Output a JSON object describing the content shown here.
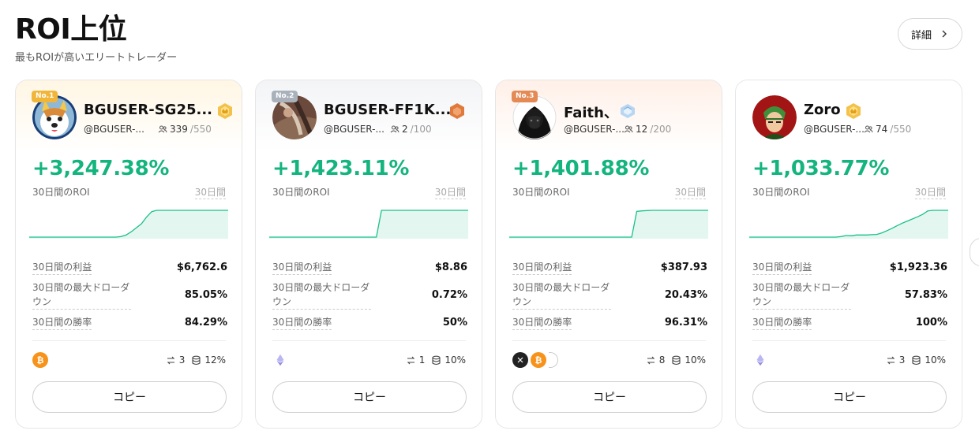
{
  "header": {
    "title": "ROI上位",
    "subtitle": "最もROIが高いエリートトレーダー",
    "detail_label": "詳細"
  },
  "cards": [
    {
      "rank": "No.1",
      "name": "BGUSER-SG25...",
      "handle": "@BGUSER-...",
      "followers": "339",
      "followers_max": "/550",
      "level": "gold-level-icon",
      "roi": "+3,247.38%",
      "roi_label": "30日間のROI",
      "period": "30日間",
      "spark": [
        0,
        0,
        0,
        0,
        0,
        0,
        0,
        0,
        0,
        0,
        0,
        0,
        0,
        0,
        0,
        0,
        0,
        0,
        0.02,
        0.08,
        0.2,
        0.35,
        0.5,
        0.75,
        0.95,
        1,
        1,
        1,
        1,
        1,
        1,
        1,
        1,
        1,
        1,
        1,
        1,
        1,
        1,
        1
      ],
      "stats": {
        "profit_label": "30日間の利益",
        "profit": "$6,762.6",
        "drawdown_label": "30日間の最大ドローダウン",
        "drawdown": "85.05%",
        "winrate_label": "30日間の勝率",
        "winrate": "84.29%"
      },
      "coins": [
        "btc"
      ],
      "trades": "3",
      "margin": "12%",
      "copy_label": "コピー"
    },
    {
      "rank": "No.2",
      "name": "BGUSER-FF1K...",
      "handle": "@BGUSER-...",
      "followers": "2",
      "followers_max": "/100",
      "level": "bronze-level-icon",
      "roi": "+1,423.11%",
      "roi_label": "30日間のROI",
      "period": "30日間",
      "spark": [
        0,
        0,
        0,
        0,
        0,
        0,
        0,
        0,
        0,
        0,
        0,
        0,
        0,
        0,
        0,
        0,
        0,
        0,
        0,
        0,
        0,
        0,
        1,
        1,
        1,
        1,
        1,
        1,
        1,
        1,
        1,
        1,
        1,
        1,
        1,
        1,
        1,
        1,
        1,
        1
      ],
      "stats": {
        "profit_label": "30日間の利益",
        "profit": "$8.86",
        "drawdown_label": "30日間の最大ドローダウン",
        "drawdown": "0.72%",
        "winrate_label": "30日間の勝率",
        "winrate": "50%"
      },
      "coins": [
        "eth"
      ],
      "trades": "1",
      "margin": "10%",
      "copy_label": "コピー"
    },
    {
      "rank": "No.3",
      "name": "Faith、",
      "handle": "@BGUSER-...",
      "followers": "12",
      "followers_max": "/200",
      "level": "diamond-level-icon",
      "roi": "+1,401.88%",
      "roi_label": "30日間のROI",
      "period": "30日間",
      "spark": [
        0,
        0,
        0,
        0,
        0,
        0,
        0,
        0,
        0,
        0,
        0,
        0,
        0,
        0,
        0,
        0,
        0,
        0,
        0,
        0,
        0,
        0,
        0,
        0,
        0,
        0.96,
        0.98,
        0.99,
        1,
        1,
        1,
        1,
        1,
        1,
        1,
        1,
        1,
        1,
        1,
        1
      ],
      "stats": {
        "profit_label": "30日間の利益",
        "profit": "$387.93",
        "drawdown_label": "30日間の最大ドローダウン",
        "drawdown": "20.43%",
        "winrate_label": "30日間の勝率",
        "winrate": "96.31%"
      },
      "coins": [
        "x",
        "btc",
        "partial"
      ],
      "trades": "8",
      "margin": "10%",
      "copy_label": "コピー"
    },
    {
      "rank": "",
      "name": "Zoro",
      "handle": "@BGUSER-...",
      "followers": "74",
      "followers_max": "/550",
      "level": "gold-level-icon",
      "roi": "+1,033.77%",
      "roi_label": "30日間のROI",
      "period": "30日間",
      "spark": [
        0,
        0,
        0,
        0,
        0,
        0,
        0,
        0,
        0,
        0,
        0,
        0,
        0,
        0,
        0,
        0,
        0,
        0,
        0.02,
        0.06,
        0.05,
        0.08,
        0.08,
        0.08,
        0.09,
        0.1,
        0.16,
        0.24,
        0.33,
        0.43,
        0.52,
        0.6,
        0.68,
        0.76,
        0.85,
        0.98,
        1,
        1,
        1,
        1
      ],
      "stats": {
        "profit_label": "30日間の利益",
        "profit": "$1,923.36",
        "drawdown_label": "30日間の最大ドローダウン",
        "drawdown": "57.83%",
        "winrate_label": "30日間の勝率",
        "winrate": "100%"
      },
      "coins": [
        "eth"
      ],
      "trades": "3",
      "margin": "10%",
      "copy_label": "コピー"
    }
  ],
  "colors": {
    "roi_green": "#14b47f",
    "spark_fill": "#e3f7f0",
    "spark_line": "#19c08a"
  }
}
